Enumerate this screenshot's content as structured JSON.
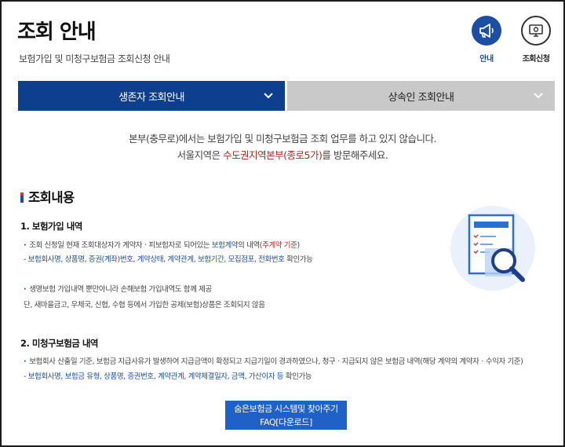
{
  "header": {
    "title": "조회 안내",
    "subtitle": "보험가입 및 미청구보험금 조회신청 안내",
    "buttons": {
      "guide_label": "안내",
      "inquiry_label": "조회신청"
    }
  },
  "tabs": [
    {
      "label": "생존자 조회안내",
      "active": true
    },
    {
      "label": "상속인 조회안내",
      "active": false
    }
  ],
  "notice": {
    "line1": "본부(충무로)에서는 보험가입 및 미청구보험금 조회 업무를 하고 있지 않습니다.",
    "line2_pre": "서울지역은 ",
    "line2_highlight": "수도권지역본부(종로5가)",
    "line2_post": "를 방문해주세요."
  },
  "section": {
    "title": "조회내용",
    "items": [
      {
        "heading": "1. 보험가입 내역",
        "p1_pre": "조회 신청일 현재 조회대상자가 계약자ㆍ피보험자로 되어있는 ",
        "p1_blue": "보험계약",
        "p1_mid": "의 내역(",
        "p1_red": "주계약 기준",
        "p1_post": ")",
        "p1_fields": "- 보험회사명, 상품명, 증권(계좌)번호, 계약상태, 계약관계, 보험기간, 모집점포, 전화번호",
        "p1_fields_post": " 확인가능",
        "p2_line1": "생명보험 가입내역 뿐만아니라 손해보험 가입내역도 함께 제공",
        "p2_line2": "단, 새마을금고, 우체국, 신협, 수협 등에서 가입한 공제(보험)상품은 조회되지 않음"
      },
      {
        "heading": "2. 미청구보험금 내역",
        "p1": "보험회사 산출일 기준, 보험금 지급사유가 발생하여 지급금액이 확정되고 지급기일이 경과하였으나, 청구ㆍ지급되지 않은 보험금 내역(해당 계약의 계약자ㆍ수익자 기준)",
        "p1_fields": "- 보험회사명, 보험금 유형, 상품명, 증권번호, 계약관계, 계약체결일자, 금액, 가산이자 등",
        "p1_fields_post": " 확인가능"
      }
    ]
  },
  "download_button": {
    "line1": "숨은보험금 시스템및 찾아주기",
    "line2": "FAQ[다운로드]"
  },
  "colors": {
    "primary": "#0e3f8e",
    "accent_blue": "#1c4fa3",
    "accent_red": "#b3261e",
    "tab_inactive": "#c9c9c9"
  }
}
